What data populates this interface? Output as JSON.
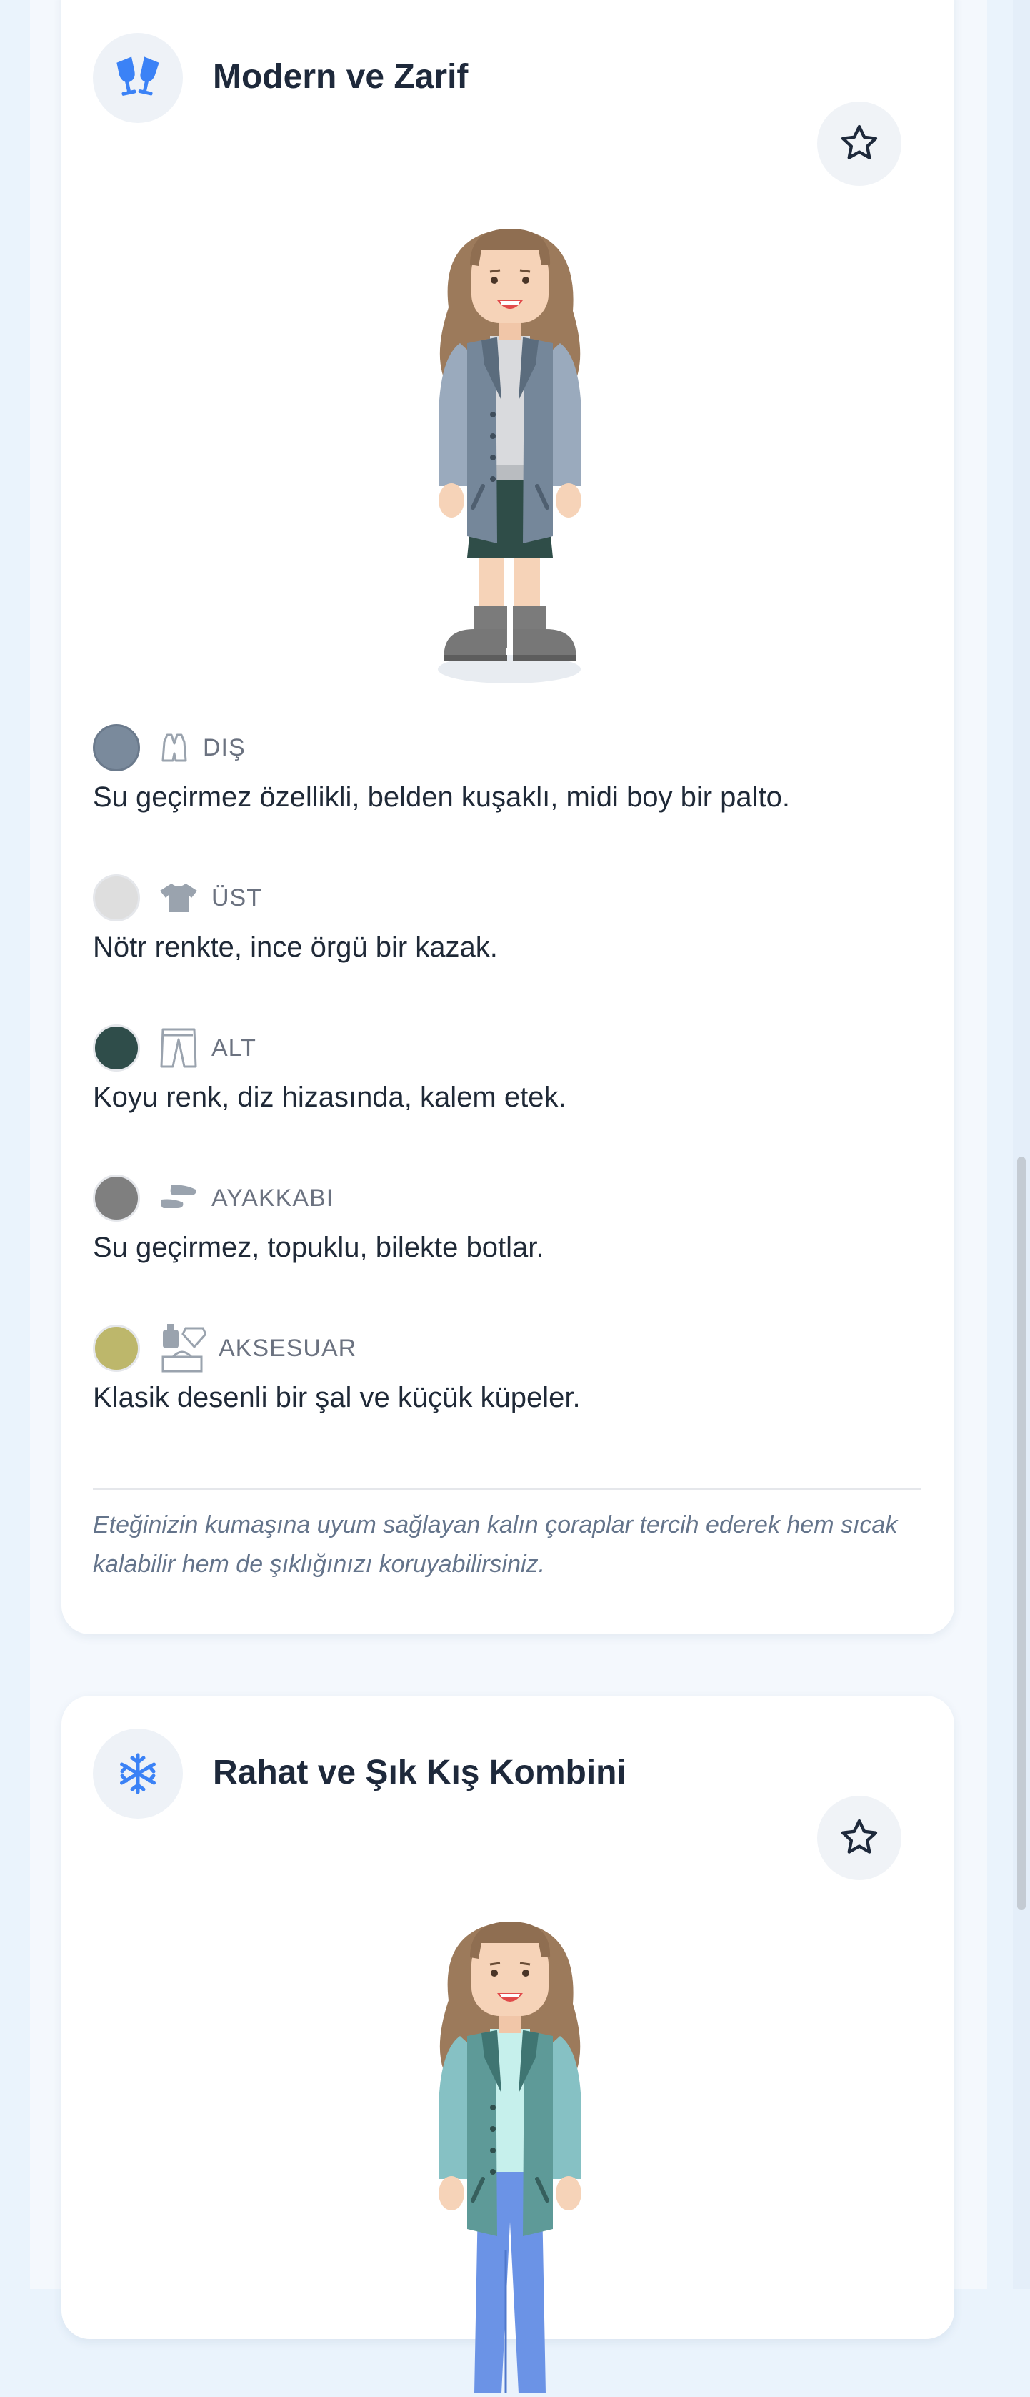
{
  "outfits": [
    {
      "title": "Modern ve Zarif",
      "title_icon": "clinking-glasses-icon",
      "favorite_icon": "star-outline-icon",
      "colors": {
        "coat": "#75879a",
        "sleeve": "#9aaabd",
        "inner": "#d9dadd",
        "skirt": "#2f4d48",
        "shoes": "#7a7a7a"
      },
      "items": [
        {
          "category": "DIŞ",
          "icon": "vest-icon",
          "color": "#7a8a9c",
          "description": "Su geçirmez özellikli, belden kuşaklı, midi boy bir palto."
        },
        {
          "category": "ÜST",
          "icon": "t-shirt-icon",
          "color": "#dedede",
          "description": "Nötr renkte, ince örgü bir kazak."
        },
        {
          "category": "ALT",
          "icon": "trousers-icon",
          "color": "#2f4d4a",
          "description": "Koyu renk, diz hizasında, kalem etek."
        },
        {
          "category": "AYAKKABI",
          "icon": "shoes-icon",
          "color": "#7f7f7f",
          "description": "Su geçirmez, topuklu, bilekte botlar."
        },
        {
          "category": "AKSESUAR",
          "icon": "accessories-icon",
          "color": "#bdb76b",
          "description": "Klasik desenli bir şal ve küçük küpeler."
        }
      ],
      "tip": "Eteğinizin kumaşına uyum sağlayan kalın çoraplar tercih ederek hem sıcak kalabilir hem de şıklığınızı koruyabilirsiniz."
    },
    {
      "title": "Rahat ve Şık Kış Kombini",
      "title_icon": "snowflake-icon",
      "favorite_icon": "star-outline-icon",
      "colors": {
        "coat": "#5e9a98",
        "sleeve": "#86c1c4",
        "inner": "#c6f0ec",
        "pants": "#6b93e6"
      }
    }
  ]
}
